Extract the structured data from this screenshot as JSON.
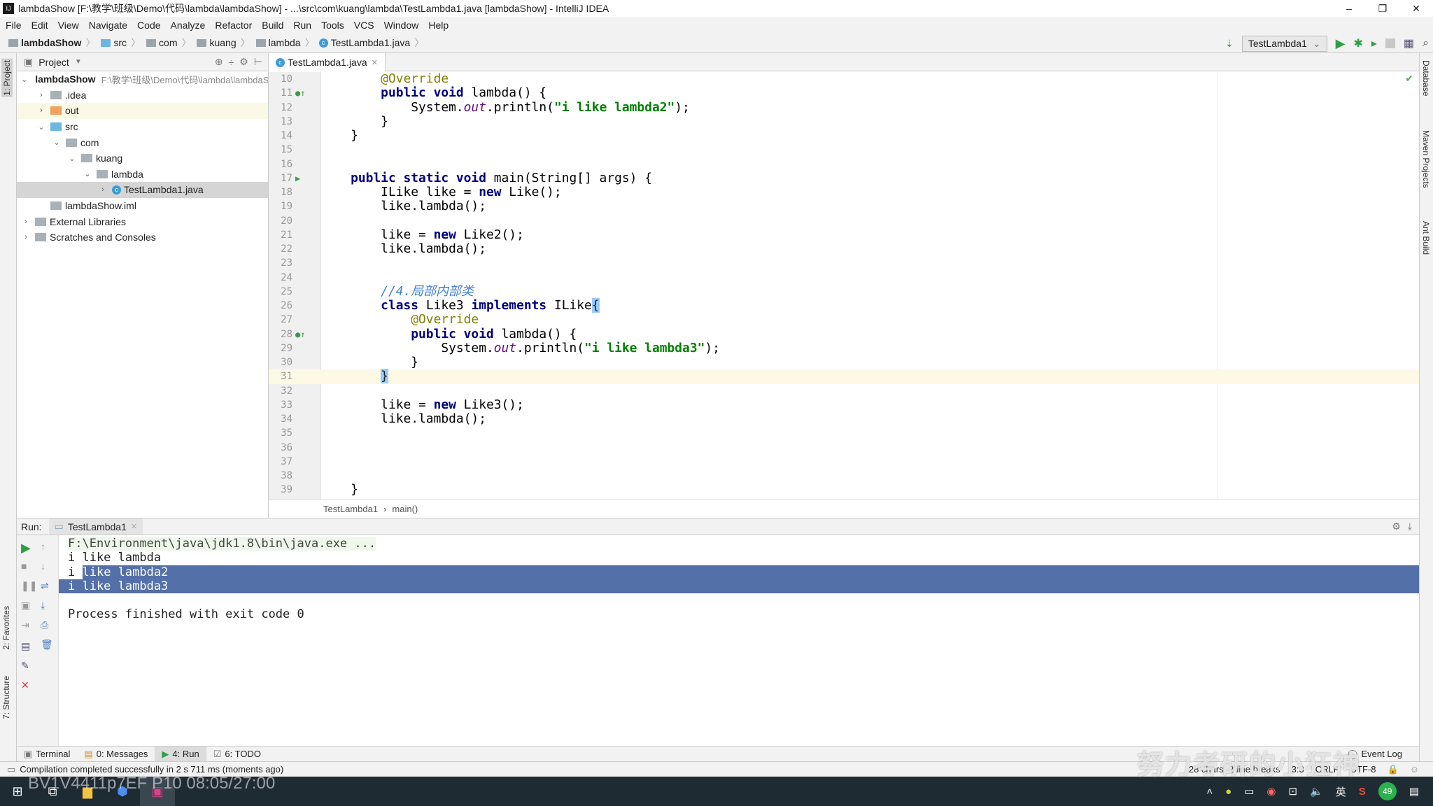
{
  "window": {
    "title": "lambdaShow [F:\\教学\\班级\\Demo\\代码\\lambda\\lambdaShow] - ...\\src\\com\\kuang\\lambda\\TestLambda1.java [lambdaShow] - IntelliJ IDEA",
    "logo": "IJ",
    "minimize": "–",
    "restore": "❐",
    "close": "✕"
  },
  "menu": [
    "File",
    "Edit",
    "View",
    "Navigate",
    "Code",
    "Analyze",
    "Refactor",
    "Build",
    "Run",
    "Tools",
    "VCS",
    "Window",
    "Help"
  ],
  "breadcrumb": [
    "lambdaShow",
    "src",
    "com",
    "kuang",
    "lambda",
    "TestLambda1.java"
  ],
  "toolbar": {
    "run_config": "TestLambda1",
    "icons": [
      "sort-icon",
      "run-icon",
      "debug-icon",
      "coverage-icon",
      "stop-icon",
      "project-structure-icon",
      "search-icon"
    ]
  },
  "left_strip": {
    "project": "1: Project",
    "favorites": "2: Favorites",
    "structure": "7: Structure"
  },
  "right_strip": {
    "database": "Database",
    "maven": "Maven Projects",
    "ant": "Ant Build"
  },
  "project": {
    "header": "Project",
    "tree": [
      {
        "label": "lambdaShow",
        "path": "F:\\教学\\班级\\Demo\\代码\\lambda\\lambdaShow",
        "depth": 0,
        "arrow": "v",
        "bold": true
      },
      {
        "label": ".idea",
        "depth": 1,
        "arrow": ">"
      },
      {
        "label": "out",
        "depth": 1,
        "arrow": ">",
        "folder_color": "#f0a060",
        "highlight": true
      },
      {
        "label": "src",
        "depth": 1,
        "arrow": "v",
        "folder_color": "#6cb6e0"
      },
      {
        "label": "com",
        "depth": 2,
        "arrow": "v"
      },
      {
        "label": "kuang",
        "depth": 3,
        "arrow": "v"
      },
      {
        "label": "lambda",
        "depth": 4,
        "arrow": "v"
      },
      {
        "label": "TestLambda1.java",
        "depth": 5,
        "arrow": ">",
        "selected": true,
        "java": true
      },
      {
        "label": "lambdaShow.iml",
        "depth": 1,
        "arrow": ""
      },
      {
        "label": "External Libraries",
        "depth": 0,
        "arrow": ">"
      },
      {
        "label": "Scratches and Consoles",
        "depth": 0,
        "arrow": ">"
      }
    ]
  },
  "editor": {
    "tab": "TestLambda1.java",
    "current_line": 31,
    "crumbs": [
      "TestLambda1",
      "main()"
    ],
    "lines": [
      {
        "n": 10,
        "t": [
          [
            "p",
            "        "
          ],
          [
            "a",
            "@Override"
          ]
        ]
      },
      {
        "n": 11,
        "m": "override",
        "t": [
          [
            "p",
            "        "
          ],
          [
            "k",
            "public void "
          ],
          [
            "p",
            "lambda() {"
          ]
        ]
      },
      {
        "n": 12,
        "t": [
          [
            "p",
            "            System."
          ],
          [
            "i",
            "out"
          ],
          [
            "p",
            ".println("
          ],
          [
            "s",
            "\"i like lambda2\""
          ],
          [
            "p",
            ");"
          ]
        ]
      },
      {
        "n": 13,
        "t": [
          [
            "p",
            "        }"
          ]
        ]
      },
      {
        "n": 14,
        "t": [
          [
            "p",
            "    }"
          ]
        ]
      },
      {
        "n": 15,
        "t": []
      },
      {
        "n": 16,
        "t": []
      },
      {
        "n": 17,
        "m": "run",
        "t": [
          [
            "p",
            "    "
          ],
          [
            "k",
            "public static void "
          ],
          [
            "p",
            "main(String[] args) {"
          ]
        ]
      },
      {
        "n": 18,
        "t": [
          [
            "p",
            "        ILike like = "
          ],
          [
            "k",
            "new "
          ],
          [
            "p",
            "Like();"
          ]
        ]
      },
      {
        "n": 19,
        "t": [
          [
            "p",
            "        like.lambda();"
          ]
        ]
      },
      {
        "n": 20,
        "t": []
      },
      {
        "n": 21,
        "t": [
          [
            "p",
            "        like = "
          ],
          [
            "k",
            "new "
          ],
          [
            "p",
            "Like2();"
          ]
        ]
      },
      {
        "n": 22,
        "t": [
          [
            "p",
            "        like.lambda();"
          ]
        ]
      },
      {
        "n": 23,
        "t": []
      },
      {
        "n": 24,
        "t": []
      },
      {
        "n": 25,
        "t": [
          [
            "p",
            "        "
          ],
          [
            "c",
            "//4.局部内部类"
          ]
        ]
      },
      {
        "n": 26,
        "t": [
          [
            "p",
            "        "
          ],
          [
            "k",
            "class "
          ],
          [
            "p",
            "Like3 "
          ],
          [
            "k",
            "implements "
          ],
          [
            "p",
            "ILike"
          ],
          [
            "br",
            "{"
          ]
        ]
      },
      {
        "n": 27,
        "t": [
          [
            "p",
            "            "
          ],
          [
            "a",
            "@Override"
          ]
        ]
      },
      {
        "n": 28,
        "m": "override",
        "t": [
          [
            "p",
            "            "
          ],
          [
            "k",
            "public void "
          ],
          [
            "p",
            "lambda() {"
          ]
        ]
      },
      {
        "n": 29,
        "t": [
          [
            "p",
            "                System."
          ],
          [
            "i",
            "out"
          ],
          [
            "p",
            ".println("
          ],
          [
            "s",
            "\"i like lambda3\""
          ],
          [
            "p",
            ");"
          ]
        ]
      },
      {
        "n": 30,
        "t": [
          [
            "p",
            "            }"
          ]
        ]
      },
      {
        "n": 31,
        "t": [
          [
            "p",
            "        "
          ],
          [
            "br",
            "}"
          ]
        ]
      },
      {
        "n": 32,
        "t": []
      },
      {
        "n": 33,
        "t": [
          [
            "p",
            "        like = "
          ],
          [
            "k",
            "new "
          ],
          [
            "p",
            "Like3();"
          ]
        ]
      },
      {
        "n": 34,
        "t": [
          [
            "p",
            "        like.lambda();"
          ]
        ]
      },
      {
        "n": 35,
        "t": []
      },
      {
        "n": 36,
        "t": []
      },
      {
        "n": 37,
        "t": []
      },
      {
        "n": 38,
        "t": []
      },
      {
        "n": 39,
        "t": [
          [
            "p",
            "    }"
          ]
        ]
      }
    ]
  },
  "run": {
    "label": "Run:",
    "tab": "TestLambda1",
    "console": {
      "command": "F:\\Environment\\java\\jdk1.8\\bin\\java.exe ...",
      "out1": "i like lambda",
      "out2_a": "i ",
      "out2_b": "like lambda2",
      "out3": "i like lambda3",
      "exit": "Process finished with exit code 0"
    }
  },
  "bottom_tabs": [
    {
      "label": "Terminal"
    },
    {
      "label": "0: Messages"
    },
    {
      "label": "4: Run",
      "active": true
    },
    {
      "label": "6: TODO"
    }
  ],
  "event_log": "Event Log",
  "status": {
    "message": "Compilation completed successfully in 2 s 711 ms (moments ago)",
    "selection": "28 chars, 2 line breaks",
    "position": "3:3",
    "line_sep": "CRLF",
    "encoding": "UTF-8"
  },
  "taskbar": {
    "tray_ime": "英",
    "tray_badge": "49"
  },
  "watermark": {
    "video": "BV1V4411p7EF P10 08:05/27:00",
    "channel": "努力考研的小狂神"
  }
}
